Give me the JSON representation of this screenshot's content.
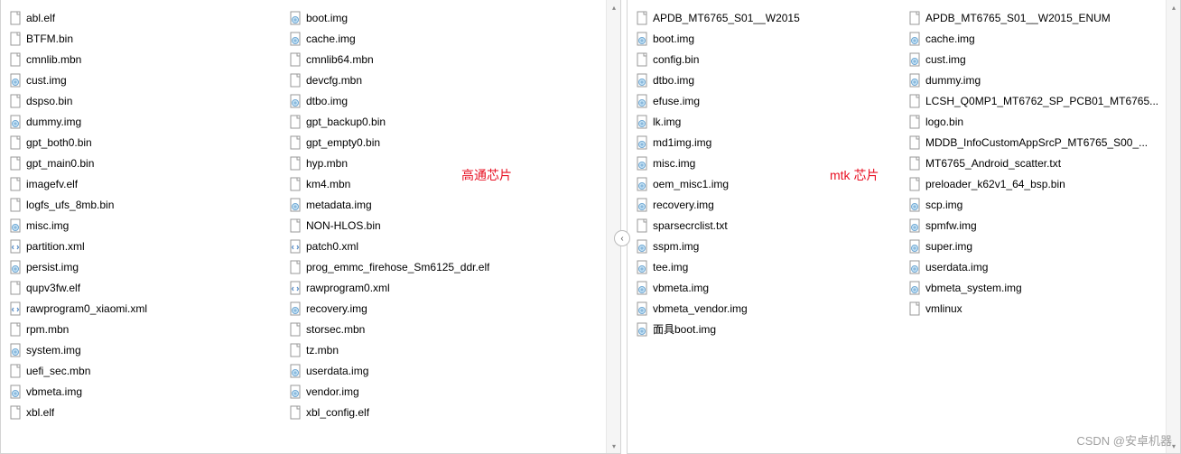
{
  "left": {
    "label": "高通芯片",
    "col1": [
      {
        "name": "abl.elf",
        "icon": "file"
      },
      {
        "name": "BTFM.bin",
        "icon": "file"
      },
      {
        "name": "cmnlib.mbn",
        "icon": "file"
      },
      {
        "name": "cust.img",
        "icon": "disk"
      },
      {
        "name": "dspso.bin",
        "icon": "file"
      },
      {
        "name": "dummy.img",
        "icon": "disk"
      },
      {
        "name": "gpt_both0.bin",
        "icon": "file"
      },
      {
        "name": "gpt_main0.bin",
        "icon": "file"
      },
      {
        "name": "imagefv.elf",
        "icon": "file"
      },
      {
        "name": "logfs_ufs_8mb.bin",
        "icon": "file"
      },
      {
        "name": "misc.img",
        "icon": "disk"
      },
      {
        "name": "partition.xml",
        "icon": "xml"
      },
      {
        "name": "persist.img",
        "icon": "disk"
      },
      {
        "name": "qupv3fw.elf",
        "icon": "file"
      },
      {
        "name": "rawprogram0_xiaomi.xml",
        "icon": "xml"
      },
      {
        "name": "rpm.mbn",
        "icon": "file"
      },
      {
        "name": "system.img",
        "icon": "disk"
      },
      {
        "name": "uefi_sec.mbn",
        "icon": "file"
      },
      {
        "name": "vbmeta.img",
        "icon": "disk"
      },
      {
        "name": "xbl.elf",
        "icon": "file"
      }
    ],
    "col2": [
      {
        "name": "boot.img",
        "icon": "disk"
      },
      {
        "name": "cache.img",
        "icon": "disk"
      },
      {
        "name": "cmnlib64.mbn",
        "icon": "file"
      },
      {
        "name": "devcfg.mbn",
        "icon": "file"
      },
      {
        "name": "dtbo.img",
        "icon": "disk"
      },
      {
        "name": "gpt_backup0.bin",
        "icon": "file"
      },
      {
        "name": "gpt_empty0.bin",
        "icon": "file"
      },
      {
        "name": "hyp.mbn",
        "icon": "file"
      },
      {
        "name": "km4.mbn",
        "icon": "file"
      },
      {
        "name": "metadata.img",
        "icon": "disk"
      },
      {
        "name": "NON-HLOS.bin",
        "icon": "file"
      },
      {
        "name": "patch0.xml",
        "icon": "xml"
      },
      {
        "name": "prog_emmc_firehose_Sm6125_ddr.elf",
        "icon": "file"
      },
      {
        "name": "rawprogram0.xml",
        "icon": "xml"
      },
      {
        "name": "recovery.img",
        "icon": "disk"
      },
      {
        "name": "storsec.mbn",
        "icon": "file"
      },
      {
        "name": "tz.mbn",
        "icon": "file"
      },
      {
        "name": "userdata.img",
        "icon": "disk"
      },
      {
        "name": "vendor.img",
        "icon": "disk"
      },
      {
        "name": "xbl_config.elf",
        "icon": "file"
      }
    ]
  },
  "right": {
    "label": "mtk 芯片",
    "col1": [
      {
        "name": "APDB_MT6765_S01__W2015",
        "icon": "file"
      },
      {
        "name": "boot.img",
        "icon": "disk"
      },
      {
        "name": "config.bin",
        "icon": "file"
      },
      {
        "name": "dtbo.img",
        "icon": "disk"
      },
      {
        "name": "efuse.img",
        "icon": "disk"
      },
      {
        "name": "lk.img",
        "icon": "disk"
      },
      {
        "name": "md1img.img",
        "icon": "disk"
      },
      {
        "name": "misc.img",
        "icon": "disk"
      },
      {
        "name": "oem_misc1.img",
        "icon": "disk"
      },
      {
        "name": "recovery.img",
        "icon": "disk"
      },
      {
        "name": "sparsecrclist.txt",
        "icon": "file"
      },
      {
        "name": "sspm.img",
        "icon": "disk"
      },
      {
        "name": "tee.img",
        "icon": "disk"
      },
      {
        "name": "vbmeta.img",
        "icon": "disk"
      },
      {
        "name": "vbmeta_vendor.img",
        "icon": "disk"
      },
      {
        "name": "面具boot.img",
        "icon": "disk"
      }
    ],
    "col2": [
      {
        "name": "APDB_MT6765_S01__W2015_ENUM",
        "icon": "file"
      },
      {
        "name": "cache.img",
        "icon": "disk"
      },
      {
        "name": "cust.img",
        "icon": "disk"
      },
      {
        "name": "dummy.img",
        "icon": "disk"
      },
      {
        "name": "LCSH_Q0MP1_MT6762_SP_PCB01_MT6765...",
        "icon": "file"
      },
      {
        "name": "logo.bin",
        "icon": "file"
      },
      {
        "name": "MDDB_InfoCustomAppSrcP_MT6765_S00_...",
        "icon": "file"
      },
      {
        "name": "MT6765_Android_scatter.txt",
        "icon": "file"
      },
      {
        "name": "preloader_k62v1_64_bsp.bin",
        "icon": "file"
      },
      {
        "name": "scp.img",
        "icon": "disk"
      },
      {
        "name": "spmfw.img",
        "icon": "disk"
      },
      {
        "name": "super.img",
        "icon": "disk"
      },
      {
        "name": "userdata.img",
        "icon": "disk"
      },
      {
        "name": "vbmeta_system.img",
        "icon": "disk"
      },
      {
        "name": "vmlinux",
        "icon": "file"
      }
    ]
  },
  "watermark": "CSDN @安卓机器",
  "divider_glyph": "‹"
}
